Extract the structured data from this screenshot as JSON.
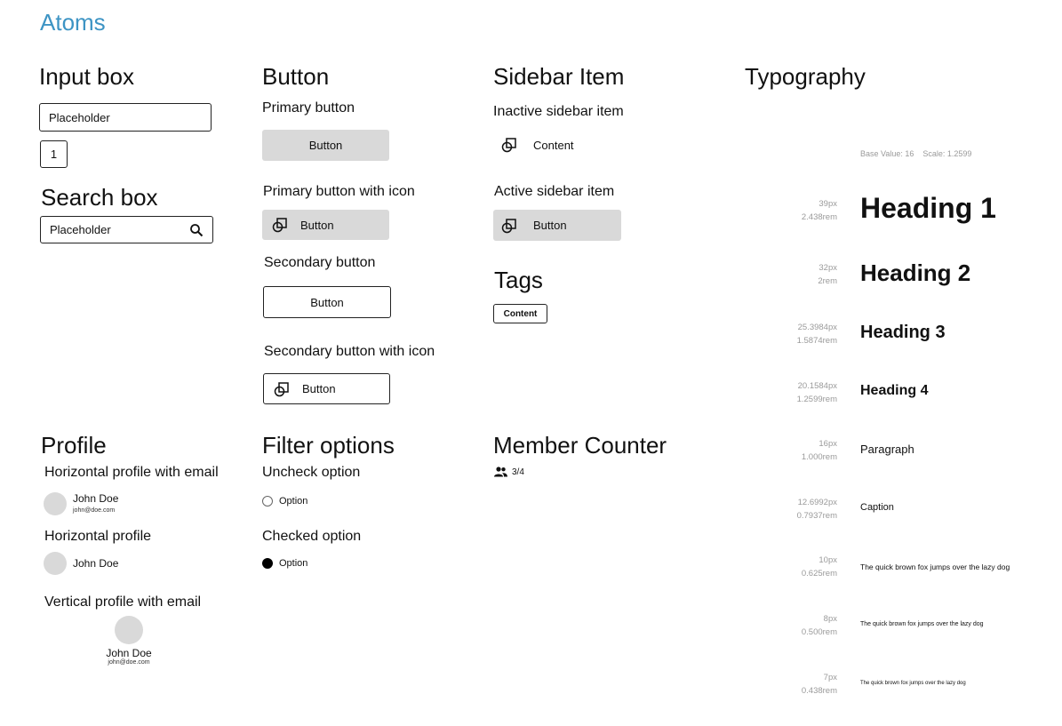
{
  "page": {
    "title": "Atoms"
  },
  "input_box": {
    "title": "Input box",
    "placeholder": "Placeholder",
    "number_value": "1"
  },
  "search_box": {
    "title": "Search box",
    "placeholder": "Placeholder",
    "icon": "search-icon"
  },
  "button": {
    "title": "Button",
    "primary_label": "Primary button",
    "primary_icon_label": "Primary button with icon",
    "secondary_label": "Secondary button",
    "secondary_icon_label": "Secondary button with icon",
    "button_text": "Button",
    "icon": "shape-icon"
  },
  "sidebar": {
    "title": "Sidebar Item",
    "inactive_label": "Inactive sidebar item",
    "inactive_text": "Content",
    "active_label": "Active sidebar item",
    "active_text": "Button"
  },
  "tags": {
    "title": "Tags",
    "tag_text": "Content"
  },
  "typography": {
    "title": "Typography",
    "base_info": "Base Value: 16    Scale: 1.2599",
    "items": [
      {
        "px": "39px",
        "rem": "2.438rem",
        "sample": "Heading 1"
      },
      {
        "px": "32px",
        "rem": "2rem",
        "sample": "Heading 2"
      },
      {
        "px": "25.3984px",
        "rem": "1.5874rem",
        "sample": "Heading 3"
      },
      {
        "px": "20.1584px",
        "rem": "1.2599rem",
        "sample": "Heading 4"
      },
      {
        "px": "16px",
        "rem": "1.000rem",
        "sample": "Paragraph"
      },
      {
        "px": "12.6992px",
        "rem": "0.7937rem",
        "sample": "Caption"
      },
      {
        "px": "10px",
        "rem": "0.625rem",
        "sample": "The quick brown fox jumps over the lazy dog"
      },
      {
        "px": "8px",
        "rem": "0.500rem",
        "sample": "The quick brown fox jumps over the lazy dog"
      },
      {
        "px": "7px",
        "rem": "0.438rem",
        "sample": "The quick brown fox jumps over the lazy dog"
      }
    ]
  },
  "profile": {
    "title": "Profile",
    "h_email_label": "Horizontal profile with email",
    "h_label": "Horizontal profile",
    "v_email_label": "Vertical profile with email",
    "name": "John Doe",
    "email": "john@doe.com"
  },
  "filter": {
    "title": "Filter options",
    "uncheck_label": "Uncheck option",
    "checked_label": "Checked option",
    "option_text": "Option"
  },
  "member_counter": {
    "title": "Member Counter",
    "value": "3/4",
    "icon": "people-icon"
  },
  "colors": {
    "accent": "#3d94c4",
    "button_gray": "#d9d9d9",
    "border": "#222222",
    "muted": "#9a9a9a"
  }
}
